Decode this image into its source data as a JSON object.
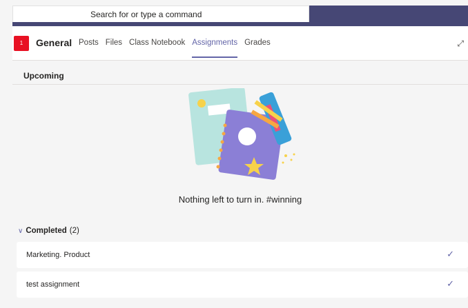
{
  "search": {
    "placeholder": "Search for or type a command"
  },
  "header": {
    "avatar_text": "1",
    "channel_name": "General",
    "tabs": [
      {
        "label": "Posts",
        "active": false
      },
      {
        "label": "Files",
        "active": false
      },
      {
        "label": "Class Notebook",
        "active": false
      },
      {
        "label": "Assignments",
        "active": true
      },
      {
        "label": "Grades",
        "active": false
      }
    ],
    "expand_icon": "expand-icon"
  },
  "upcoming": {
    "title": "Upcoming",
    "empty_message": "Nothing left to turn in. #winning"
  },
  "completed": {
    "label": "Completed",
    "count": "(2)",
    "items": [
      {
        "title": "Marketing. Product"
      },
      {
        "title": "test assignment"
      }
    ]
  },
  "colors": {
    "accent": "#6264a7",
    "titlebar": "#464775",
    "avatar": "#e81123"
  }
}
